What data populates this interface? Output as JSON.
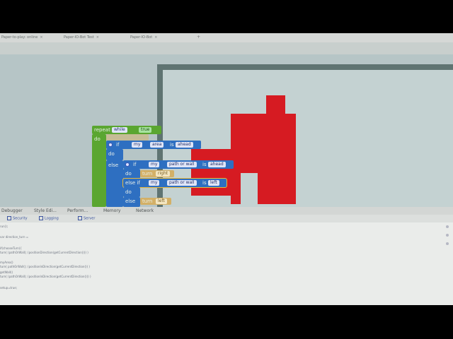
{
  "browser": {
    "tabs": [
      {
        "label": "Paper-to-play: online"
      },
      {
        "label": "Paper-IO-Bot Test"
      },
      {
        "label": "Paper-IO-Bot"
      }
    ],
    "new_tab_glyph": "+"
  },
  "blocks": {
    "repeat": {
      "keyword": "repeat",
      "mode": "while",
      "condition": "true",
      "do_label": "do"
    },
    "if_outer": {
      "keyword": "if",
      "subject": "my",
      "object": "area",
      "op": "is",
      "value": "ahead",
      "do_label": "do",
      "else_label": "else"
    },
    "if_inner": {
      "keyword": "if",
      "subject": "my",
      "object": "path or wall",
      "op": "is",
      "value": "ahead",
      "do_label": "do"
    },
    "turn_right": {
      "keyword": "turn",
      "value": "right"
    },
    "else_if": {
      "keyword": "else if",
      "subject": "my",
      "object": "path or wall",
      "op": "is",
      "value": "left",
      "do_label": "do"
    },
    "else_final": {
      "label": "else"
    },
    "turn_left": {
      "keyword": "turn",
      "value": "left"
    }
  },
  "devtools": {
    "tabs": [
      "Debugger",
      "Style Edi...",
      "Perform...",
      "Memory",
      "Network"
    ],
    "subtabs": [
      "Security",
      "Logging",
      "Server"
    ],
    "log_lines": [
      "run();",
      "var direction_turn =",
      "if(chooseTurn){",
      "turn( (pathOrWall); (positionDirection(getCurrentDirection())) )",
      "myArea()",
      "turn( pathOrWall(); (positionInDirection(getCurrentDirection()) )",
      "getWall()",
      "turn( (pathOrWall); (positionInDirection(getCurrentDirection())) )",
      "setup=true;"
    ]
  },
  "colors": {
    "loop_green": "#5aa630",
    "logic_blue": "#2e6fc1",
    "control_gold": "#d3b067",
    "wall_red": "#d61b22",
    "stage_bg": "#c4d2d2"
  }
}
